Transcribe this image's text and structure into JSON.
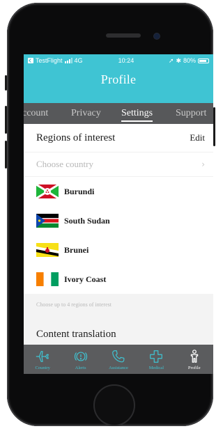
{
  "status_bar": {
    "back_app": "TestFlight",
    "network": "4G",
    "time": "10:24",
    "battery": "80%",
    "battery_level": 0.8
  },
  "header": {
    "title": "Profile"
  },
  "tabs": [
    {
      "label": "Account",
      "visible_text": "ccount",
      "active": false
    },
    {
      "label": "Privacy",
      "active": false
    },
    {
      "label": "Settings",
      "active": true
    },
    {
      "label": "Support",
      "active": false
    }
  ],
  "regions": {
    "heading": "Regions of interest",
    "edit_label": "Edit",
    "choose_placeholder": "Choose country",
    "countries": [
      {
        "name": "Burundi",
        "flag": "burundi-flag"
      },
      {
        "name": "South Sudan",
        "flag": "south-sudan-flag"
      },
      {
        "name": "Brunei",
        "flag": "brunei-flag"
      },
      {
        "name": "Ivory Coast",
        "flag": "ivory-coast-flag"
      }
    ],
    "hint": "Choose up to 4 regions of interest"
  },
  "translation": {
    "heading": "Content translation"
  },
  "bottom_tabs": [
    {
      "label": "Country",
      "icon": "plane-icon",
      "active": false
    },
    {
      "label": "Alerts",
      "icon": "alert-icon",
      "active": false
    },
    {
      "label": "Assistance",
      "icon": "phone-icon",
      "active": false
    },
    {
      "label": "Medical",
      "icon": "medical-cross-icon",
      "active": false
    },
    {
      "label": "Profile",
      "icon": "person-icon",
      "active": true
    }
  ],
  "colors": {
    "accent": "#3fc4d3",
    "tab_bar": "#57585a",
    "bottom_bar": "#5b5c5e"
  }
}
